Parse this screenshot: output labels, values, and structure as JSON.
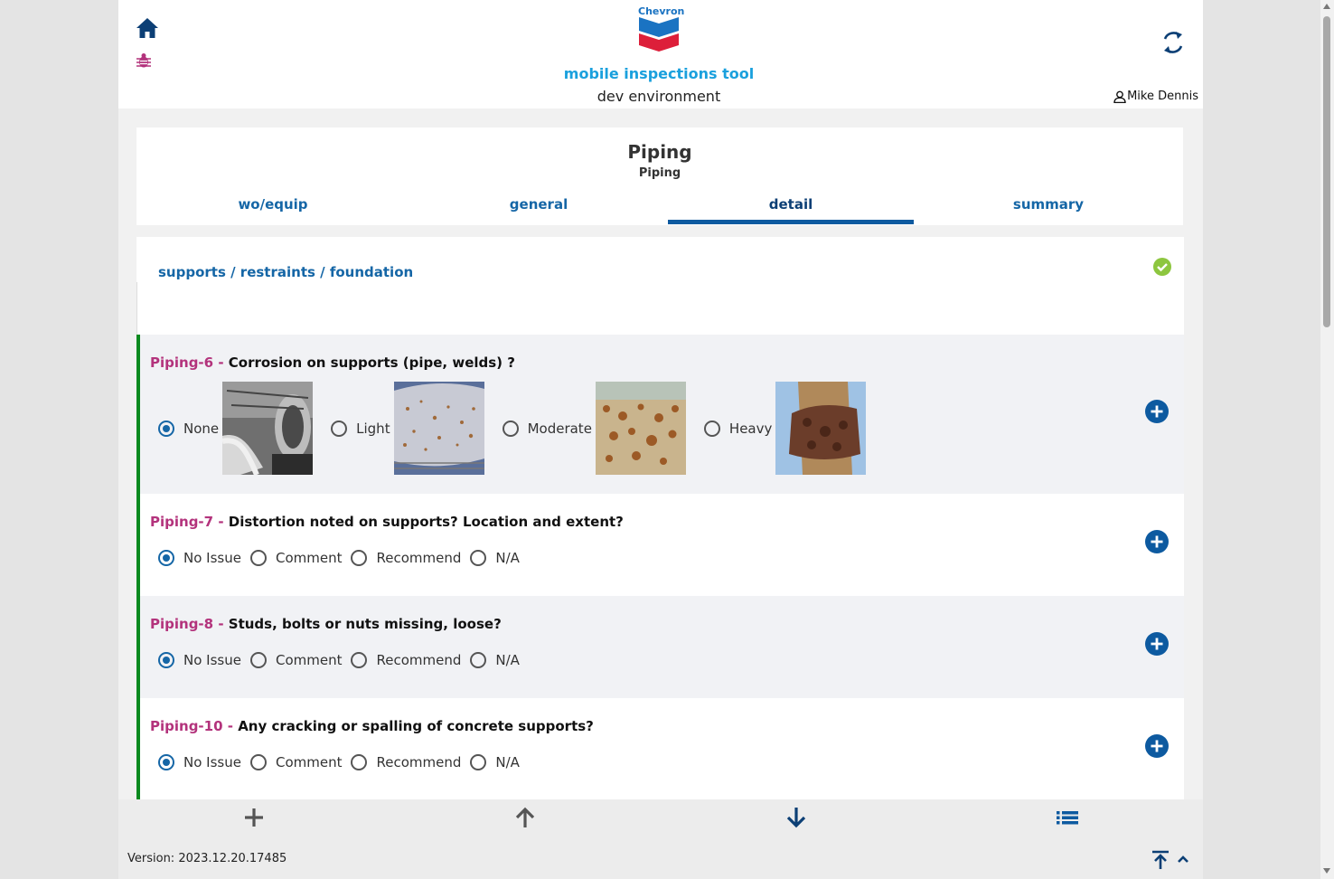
{
  "header": {
    "logo_text": "Chevron",
    "app_title": "mobile inspections tool",
    "environment": "dev environment",
    "user_name": "Mike Dennis",
    "icons": {
      "home": "home-icon",
      "debug": "bug-icon",
      "sync": "sync-icon",
      "user": "user-icon"
    }
  },
  "form": {
    "title": "Piping",
    "subtitle": "Piping",
    "tabs": [
      {
        "label": "wo/equip",
        "active": false
      },
      {
        "label": "general",
        "active": false
      },
      {
        "label": "detail",
        "active": true
      },
      {
        "label": "summary",
        "active": false
      }
    ]
  },
  "section": {
    "title": "supports / restraints / foundation",
    "status_icon": "check-circle-icon",
    "status_color": "#8dc63f"
  },
  "questions": [
    {
      "code": "Piping-6 - ",
      "text": "Corrosion on supports (pipe, welds) ?",
      "options": [
        {
          "label": "None",
          "selected": true,
          "photo": "insulated-flange-pipe"
        },
        {
          "label": "Light",
          "selected": false,
          "photo": "light-surface-rust"
        },
        {
          "label": "Moderate",
          "selected": false,
          "photo": "moderate-pitted-rust"
        },
        {
          "label": "Heavy",
          "selected": false,
          "photo": "heavy-scaled-corrosion"
        }
      ]
    },
    {
      "code": "Piping-7 - ",
      "text": "Distortion noted on supports? Location and extent?",
      "options": [
        {
          "label": "No Issue",
          "selected": true
        },
        {
          "label": "Comment",
          "selected": false
        },
        {
          "label": "Recommend",
          "selected": false
        },
        {
          "label": "N/A",
          "selected": false
        }
      ]
    },
    {
      "code": "Piping-8 - ",
      "text": "Studs, bolts or nuts missing, loose?",
      "options": [
        {
          "label": "No Issue",
          "selected": true
        },
        {
          "label": "Comment",
          "selected": false
        },
        {
          "label": "Recommend",
          "selected": false
        },
        {
          "label": "N/A",
          "selected": false
        }
      ]
    },
    {
      "code": "Piping-10 - ",
      "text": "Any cracking or spalling of concrete supports?",
      "options": [
        {
          "label": "No Issue",
          "selected": true
        },
        {
          "label": "Comment",
          "selected": false
        },
        {
          "label": "Recommend",
          "selected": false
        },
        {
          "label": "N/A",
          "selected": false
        }
      ]
    }
  ],
  "footer": {
    "version": "Version: 2023.12.20.17485",
    "nav_icons": [
      "add-icon",
      "arrow-up-icon",
      "arrow-down-icon",
      "list-icon"
    ]
  },
  "colors": {
    "primary_blue": "#1566a6",
    "question_code": "#b3337c",
    "accent_green": "#0b8a1f",
    "title_cyan": "#1aa0dd"
  }
}
